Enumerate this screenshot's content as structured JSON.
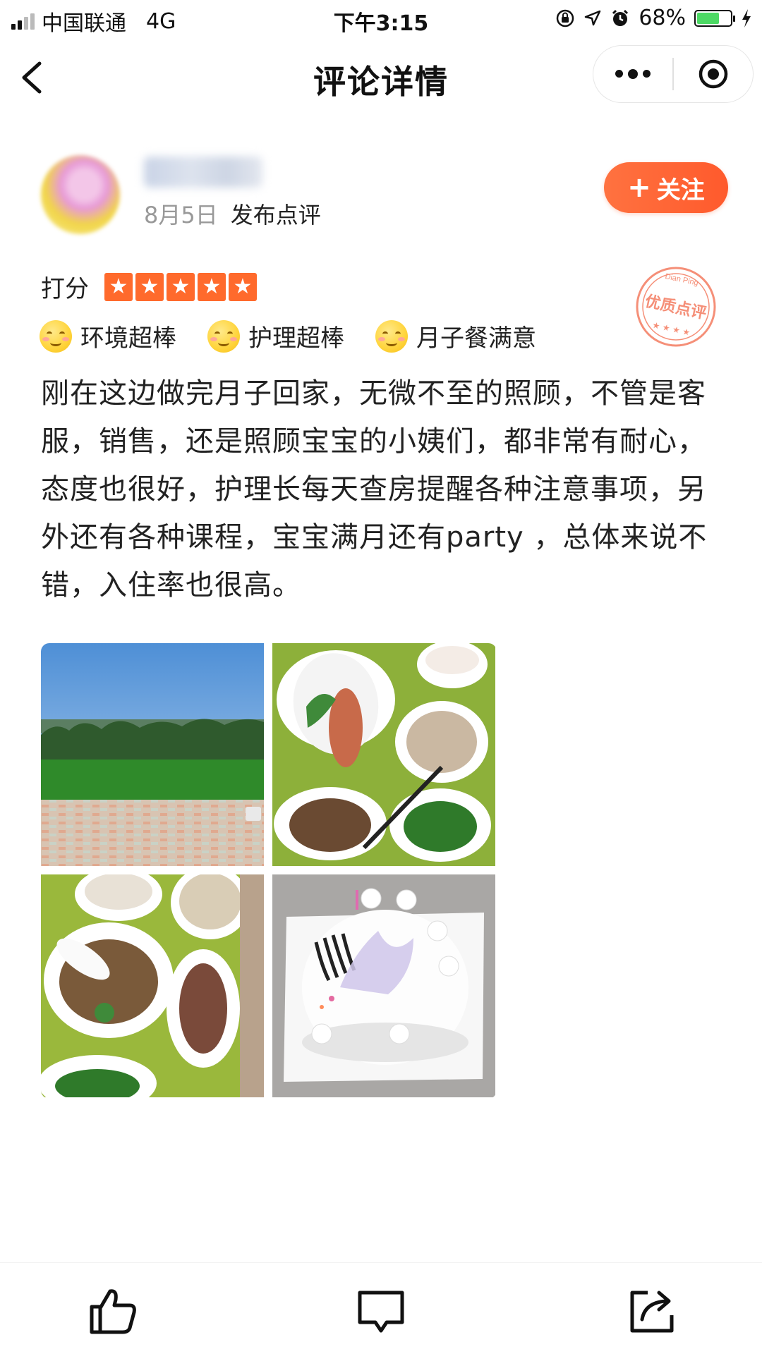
{
  "status_bar": {
    "carrier": "中国联通",
    "network": "4G",
    "time": "下午3:15",
    "battery": "68%",
    "battery_level": 0.68
  },
  "nav": {
    "title": "评论详情",
    "icons": [
      "back-icon",
      "more-dots-icon",
      "close-target-icon"
    ]
  },
  "user": {
    "name": "",
    "date": "8月5日",
    "action": "发布点评",
    "follow_label": "关注"
  },
  "rating": {
    "label": "打分",
    "stars": 5,
    "max": 5,
    "star_color": "#ff6a2c"
  },
  "stamp": {
    "text": "优质点评",
    "subtext": "Dian Ping",
    "color": "#f26a4b"
  },
  "tags": [
    {
      "label": "环境超棒",
      "icon": "smile-face-icon"
    },
    {
      "label": "护理超棒",
      "icon": "smile-face-icon"
    },
    {
      "label": "月子餐满意",
      "icon": "smile-face-icon"
    }
  ],
  "review": {
    "text": "刚在这边做完月子回家，无微不至的照顾，不管是客服，销售，还是照顾宝宝的小姨们，都非常有耐心，态度也很好，护理长每天查房提醒各种注意事项，另外还有各种课程，宝宝满月还有party ，总体来说不错，入住率也很高。"
  },
  "photos": [
    {
      "subject": "garden-lawn-photo"
    },
    {
      "subject": "meal-tray-photo"
    },
    {
      "subject": "soup-meal-photo"
    },
    {
      "subject": "cake-photo"
    }
  ],
  "bottom_bar": {
    "icons": [
      "thumbs-up-icon",
      "comment-icon",
      "share-icon"
    ]
  },
  "colors": {
    "accent": "#ff5a2c",
    "text": "#222222",
    "muted": "#999999"
  }
}
